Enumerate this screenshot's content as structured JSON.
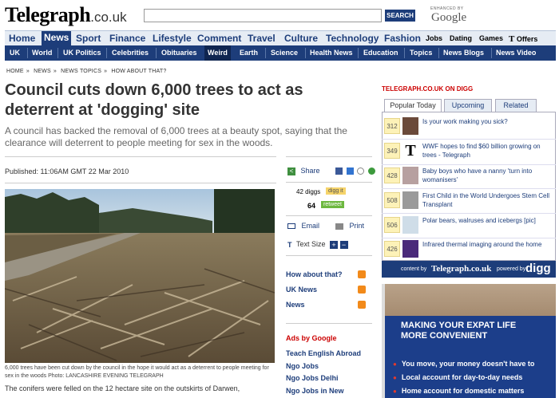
{
  "masthead": {
    "logo": "Telegraph",
    "logo_domain": ".co.uk",
    "search_placeholder": "",
    "search_button": "SEARCH",
    "powered_by": "ENHANCED BY",
    "google": "Google"
  },
  "nav_primary": [
    "Home",
    "News",
    "Sport",
    "Finance",
    "Lifestyle",
    "Comment",
    "Travel",
    "Culture",
    "Technology",
    "Fashion",
    "Jobs",
    "Dating",
    "Games",
    "Offers"
  ],
  "nav_primary_selected": "News",
  "nav_secondary": [
    "UK",
    "World",
    "UK Politics",
    "Celebrities",
    "Obituaries",
    "Weird",
    "Earth",
    "Science",
    "Health News",
    "Education",
    "Topics",
    "News Blogs",
    "News Video"
  ],
  "nav_secondary_selected": "Weird",
  "breadcrumb": [
    "HOME",
    "NEWS",
    "NEWS TOPICS",
    "HOW ABOUT THAT?"
  ],
  "article": {
    "headline": "Council cuts down 6,000 trees to act as deterrent at 'dogging' site",
    "standfirst": "A council has backed the removal of 6,000 trees at a beauty spot, saying that the clearance will deterrent to people meeting for sex in the woods.",
    "published": "Published: 11:06AM GMT 22 Mar 2010",
    "caption": "6,000 trees have been cut down by the council in the hope it would act as a deterrent to people meeting for sex in the woods  Photo: LANCASHIRE EVENING TELEGRAPH",
    "body_start": "The conifers were felled on the 12 hectare site on the outskirts of Darwen,"
  },
  "tools": {
    "share": "Share",
    "digg_count": "42 diggs",
    "digg_it": "digg it",
    "retweet_count": "64",
    "retweet": "retweet",
    "email": "Email",
    "print": "Print",
    "text_size": "Text Size"
  },
  "section_links": [
    "How about that?",
    "UK News",
    "News"
  ],
  "ads": {
    "header": "Ads by Google",
    "links": [
      "Teach English Abroad",
      "Ngo Jobs",
      "Ngo Jobs Delhi",
      "Ngo Jobs in New"
    ]
  },
  "digg_panel": {
    "title": "TELEGRAPH.CO.UK ON DIGG",
    "tabs": [
      "Popular Today",
      "Upcoming",
      "Related"
    ],
    "stories": [
      {
        "count": "312",
        "text": "Is your work making you sick?"
      },
      {
        "count": "349",
        "text": "WWF hopes to find $60 billion growing on trees - Telegraph"
      },
      {
        "count": "428",
        "text": "Baby boys who have a nanny 'turn into womanisers'"
      },
      {
        "count": "508",
        "text": "First Child in the World Undergoes Stem Cell Transplant"
      },
      {
        "count": "506",
        "text": "Polar bears, walruses and icebergs [pic]"
      },
      {
        "count": "426",
        "text": "Infrared thermal imaging around the home"
      }
    ],
    "footer_content_by": "content by",
    "footer_telegraph": "Telegraph.co.uk",
    "footer_powered": "powered by",
    "footer_digg": "digg"
  },
  "ad_banner": {
    "headline_1": "MAKING YOUR EXPAT LIFE",
    "headline_2": "MORE CONVENIENT",
    "bullets": [
      "You move, your money doesn't have to",
      "Local account for day-to-day needs",
      "Home account for domestic matters"
    ]
  },
  "colors": {
    "brand_blue": "#1d3d7a",
    "accent_red": "#cc0000",
    "rss_orange": "#f28a1a"
  }
}
